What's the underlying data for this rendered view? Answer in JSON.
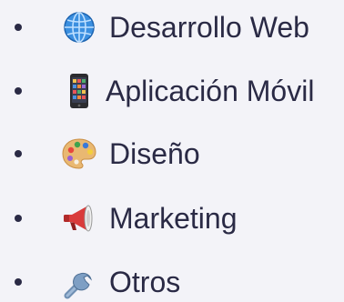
{
  "menu": {
    "items": [
      {
        "label": "Desarrollo Web",
        "icon": "globe-icon"
      },
      {
        "label": "Aplicación Móvil",
        "icon": "mobile-phone-icon"
      },
      {
        "label": "Diseño",
        "icon": "palette-icon"
      },
      {
        "label": "Marketing",
        "icon": "megaphone-icon"
      },
      {
        "label": "Otros",
        "icon": "wrench-icon"
      }
    ]
  }
}
